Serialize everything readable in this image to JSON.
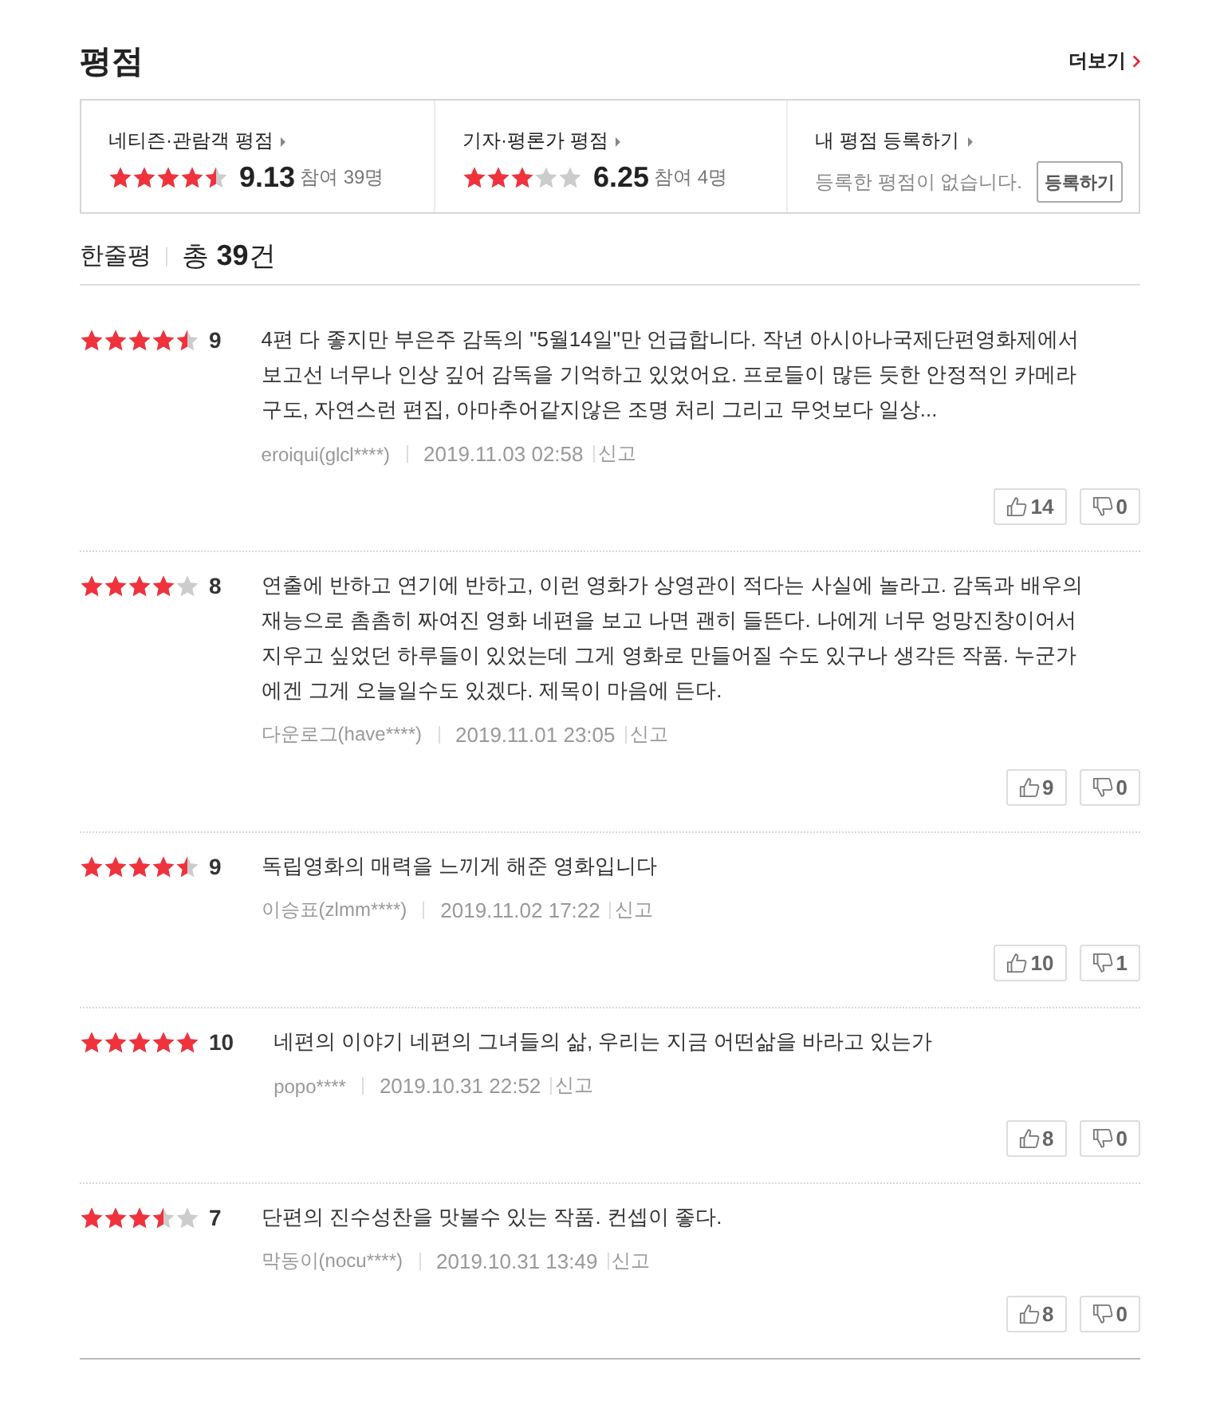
{
  "section": {
    "title": "평점",
    "more_link": "더보기"
  },
  "summary": [
    {
      "kind": "score",
      "label": "네티즌·관람객 평점",
      "stars": 4.5,
      "score": "9.13",
      "participants": "참여 39명"
    },
    {
      "kind": "score",
      "label": "기자·평론가 평점",
      "stars": 3,
      "score": "6.25",
      "participants": "참여 4명"
    },
    {
      "kind": "register",
      "label": "내 평점 등록하기",
      "message": "등록한 평점이 없습니다.",
      "button": "등록하기"
    }
  ],
  "reviews_header": {
    "title": "한줄평",
    "total": "총 **39**건"
  },
  "reviews": [
    {
      "stars": 4.5,
      "score": "9",
      "text": "4편 다 좋지만 부은주 감독의 \"5월14일\"만 언급합니다. 작년 아시아나국제단편영화제에서 보고선 너무나 인상 깊어 감독을 기억하고 있었어요. 프로들이 많든 듯한 안정적인 카메라 구도, 자연스런 편집, 아마추어같지않은 조명 처리 그리고 무엇보다 일상...",
      "author": "eroiqui(glcl****)",
      "date": "2019.11.03 02:58",
      "report": "신고",
      "likes": "14",
      "dislikes": "0"
    },
    {
      "stars": 4,
      "score": "8",
      "text": "연출에 반하고 연기에 반하고, 이런 영화가 상영관이 적다는 사실에 놀라고. 감독과 배우의 재능으로 촘촘히 짜여진 영화 네편을 보고 나면 괜히 들뜬다. 나에게 너무 엉망진창이어서 지우고 싶었던 하루들이 있었는데 그게 영화로 만들어질 수도 있구나 생각든 작품. 누군가에겐 그게 오늘일수도 있겠다. 제목이 마음에 든다.",
      "author": "다운로그(have****)",
      "date": "2019.11.01 23:05",
      "report": "신고",
      "likes": "9",
      "dislikes": "0"
    },
    {
      "stars": 4.5,
      "score": "9",
      "text": "독립영화의 매력을 느끼게 해준 영화입니다",
      "author": "이승표(zlmm****)",
      "date": "2019.11.02 17:22",
      "report": "신고",
      "likes": "10",
      "dislikes": "1"
    },
    {
      "stars": 5,
      "score": "10",
      "text": "네편의 이야기 네편의 그녀들의 삶, 우리는 지금 어떤삶을 바라고 있는가",
      "author": "popo****",
      "date": "2019.10.31 22:52",
      "report": "신고",
      "likes": "8",
      "dislikes": "0"
    },
    {
      "stars": 3.5,
      "score": "7",
      "text": "단편의 진수성찬을 맛볼수 있는 작품. 컨셉이 좋다.",
      "author": "막동이(nocu****)",
      "date": "2019.10.31 13:49",
      "report": "신고",
      "likes": "8",
      "dislikes": "0"
    }
  ]
}
